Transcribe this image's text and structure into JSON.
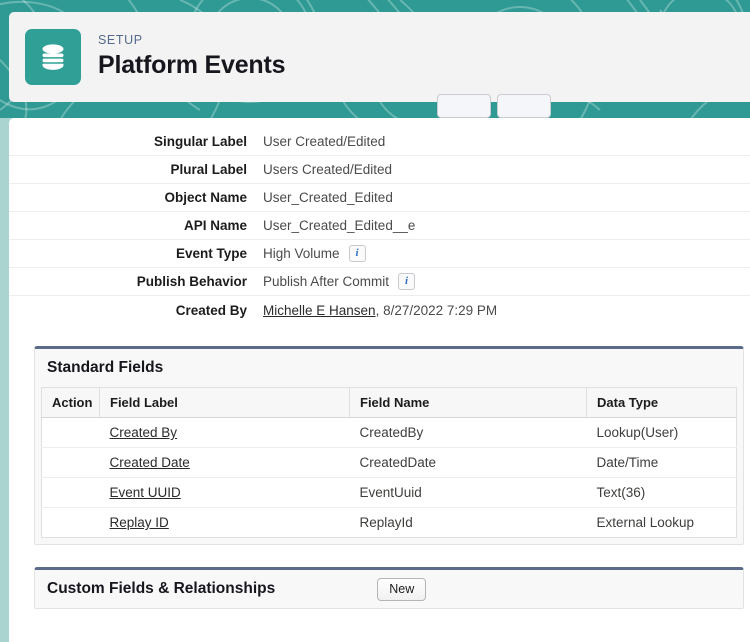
{
  "header": {
    "eyebrow": "SETUP",
    "title": "Platform Events",
    "icon": "database-stack-icon",
    "icon_color": "#30a096",
    "banner_color": "#2f9a94",
    "eyebrow_color": "#56698d"
  },
  "detail": {
    "rows": [
      {
        "label": "Singular Label",
        "value": "User Created/Edited",
        "info": false
      },
      {
        "label": "Plural Label",
        "value": "Users Created/Edited",
        "info": false
      },
      {
        "label": "Object Name",
        "value": "User_Created_Edited",
        "info": false
      },
      {
        "label": "API Name",
        "value": "User_Created_Edited__e",
        "info": false
      },
      {
        "label": "Event Type",
        "value": "High Volume",
        "info": true
      },
      {
        "label": "Publish Behavior",
        "value": "Publish After Commit",
        "info": true
      }
    ],
    "created_by": {
      "label": "Created By",
      "user": "Michelle E Hansen",
      "separator": ",",
      "timestamp": "8/27/2022 7:29 PM"
    },
    "info_icon_glyph": "i"
  },
  "standard_fields": {
    "title": "Standard Fields",
    "columns": [
      "Action",
      "Field Label",
      "Field Name",
      "Data Type"
    ],
    "rows": [
      {
        "action": "",
        "field_label": "Created By",
        "field_name": "CreatedBy",
        "data_type": "Lookup(User)"
      },
      {
        "action": "",
        "field_label": "Created Date",
        "field_name": "CreatedDate",
        "data_type": "Date/Time"
      },
      {
        "action": "",
        "field_label": "Event UUID",
        "field_name": "EventUuid",
        "data_type": "Text(36)"
      },
      {
        "action": "",
        "field_label": "Replay ID",
        "field_name": "ReplayId",
        "data_type": "External Lookup"
      }
    ]
  },
  "custom_fields": {
    "title": "Custom Fields & Relationships",
    "new_label": "New"
  }
}
